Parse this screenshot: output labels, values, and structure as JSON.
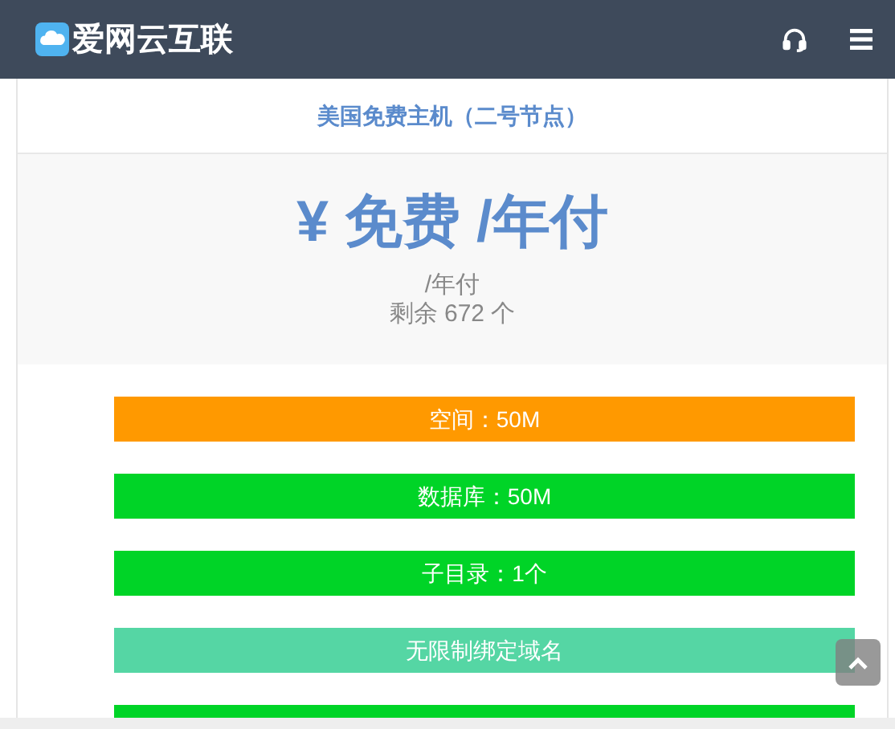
{
  "header": {
    "brand": "爱网云互联"
  },
  "plan": {
    "title": "美国免费主机（二号节点）",
    "price": "¥ 免费 /年付",
    "period": "/年付",
    "stock": "剩余 672 个"
  },
  "features": [
    {
      "label": "空间：50M",
      "color": "#ff9900"
    },
    {
      "label": "数据库：50M",
      "color": "#00d427"
    },
    {
      "label": "子目录：1个",
      "color": "#00d427"
    },
    {
      "label": "无限制绑定域名",
      "color": "#55d6a4"
    },
    {
      "color": "#00d427"
    }
  ]
}
